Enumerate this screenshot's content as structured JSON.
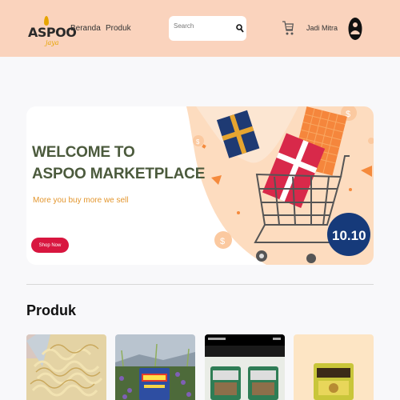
{
  "header": {
    "logo_text": "ASPOO",
    "logo_sub": "jaya",
    "nav": [
      {
        "label": "Beranda"
      },
      {
        "label": "Produk"
      }
    ],
    "search": {
      "placeholder": "Search"
    },
    "mitra_label": "Jadi Mitra",
    "icons": {
      "search": "search-icon",
      "cart": "cart-icon",
      "account": "account-icon"
    }
  },
  "banner": {
    "title_line1": "WELCOME TO",
    "title_line2": "ASPOO MARKETPLACE",
    "tagline": "More you buy more we sell",
    "button": "Shop Now",
    "sale_badge": "10.10"
  },
  "products_section": {
    "title": "Produk",
    "cards": [
      {
        "image": "noodle-snack-image"
      },
      {
        "image": "package-on-flowers-image"
      },
      {
        "image": "snack-packs-screenshot-image"
      },
      {
        "image": "yellow-snack-pack-image"
      }
    ]
  },
  "colors": {
    "header_bg": "#fad3bd",
    "accent_red": "#d8163f",
    "title_green": "#4b5a3c",
    "tagline_orange": "#e3962e",
    "badge_navy": "#163a7a"
  }
}
